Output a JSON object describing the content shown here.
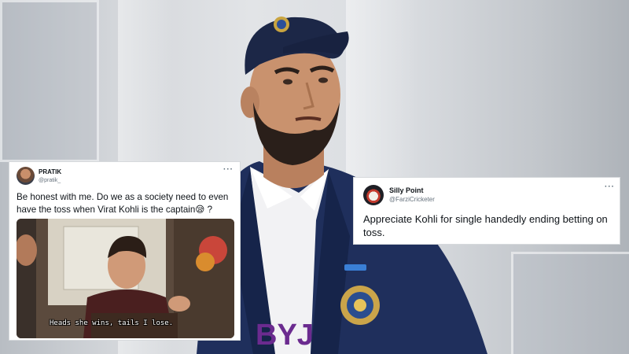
{
  "tweets": [
    {
      "name": "PRATIK",
      "handle": "@pratik_",
      "more": "···",
      "text": "Be honest with me. Do we as a society need to even have the toss when Virat Kohli is the captain",
      "emoji": "😪",
      "suffix": " ?",
      "meme_caption": "Heads she wins, tails I lose."
    },
    {
      "name": "Silly Point",
      "handle": "@FarziCricketer",
      "more": "···",
      "text": "Appreciate Kohli for single handedly ending betting on toss."
    }
  ],
  "jersey_text": "BYJ",
  "colors": {
    "blazer": "#1f2f5c",
    "cap": "#1c2747",
    "skin": "#c9926e",
    "beard": "#2a1f1a"
  }
}
